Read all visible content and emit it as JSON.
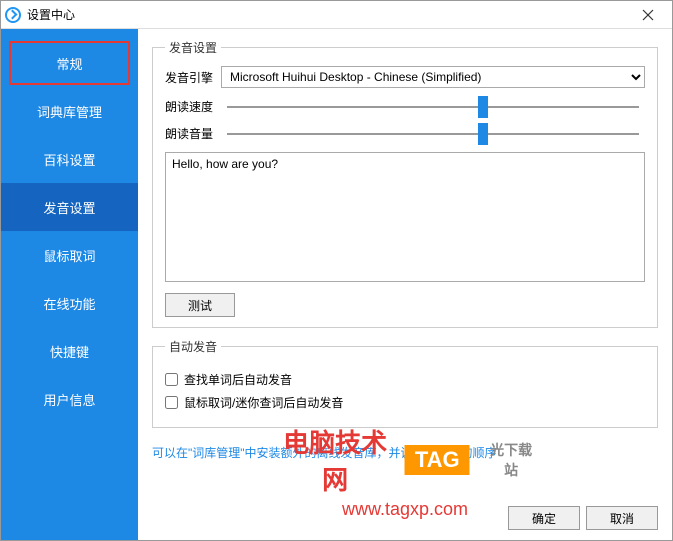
{
  "titlebar": {
    "title": "设置中心"
  },
  "sidebar": {
    "items": [
      {
        "label": "常规"
      },
      {
        "label": "词典库管理"
      },
      {
        "label": "百科设置"
      },
      {
        "label": "发音设置"
      },
      {
        "label": "鼠标取词"
      },
      {
        "label": "在线功能"
      },
      {
        "label": "快捷键"
      },
      {
        "label": "用户信息"
      }
    ]
  },
  "voiceSettings": {
    "groupTitle": "发音设置",
    "engineLabel": "发音引擎",
    "engineValue": "Microsoft Huihui Desktop - Chinese (Simplified)",
    "speedLabel": "朗读速度",
    "volumeLabel": "朗读音量",
    "testText": "Hello, how are you?",
    "testButton": "测试"
  },
  "autoVoice": {
    "groupTitle": "自动发音",
    "check1": "查找单词后自动发音",
    "check2": "鼠标取词/迷你查词后自动发音"
  },
  "hint": "可以在\"词库管理\"中安装额外的离线发音库，并调整发音库的顺序",
  "footer": {
    "ok": "确定",
    "cancel": "取消"
  },
  "watermark": {
    "text1": "电脑技术网",
    "tag": "TAG",
    "side": "光下载站",
    "url": "www.tagxp.com"
  }
}
